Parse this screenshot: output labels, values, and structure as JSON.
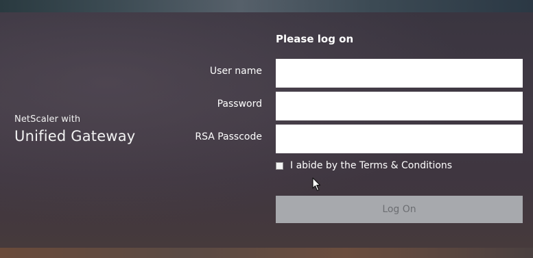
{
  "brand": {
    "line1": "NetScaler with",
    "line2": "Unified Gateway"
  },
  "form": {
    "title": "Please log on",
    "fields": [
      {
        "label": "User name",
        "value": "",
        "placeholder": ""
      },
      {
        "label": "Password",
        "value": "",
        "placeholder": ""
      },
      {
        "label": "RSA Passcode",
        "value": "",
        "placeholder": ""
      }
    ],
    "terms": {
      "label": "I abide by the Terms & Conditions",
      "checked": false
    },
    "submit_label": "Log On"
  },
  "colors": {
    "button_disabled_bg": "#a7a9ad",
    "button_disabled_text": "#6c6e72",
    "panel_bg": "#3d373f",
    "text": "#ffffff"
  },
  "icons": {
    "cursor": "mouse-pointer-icon"
  }
}
